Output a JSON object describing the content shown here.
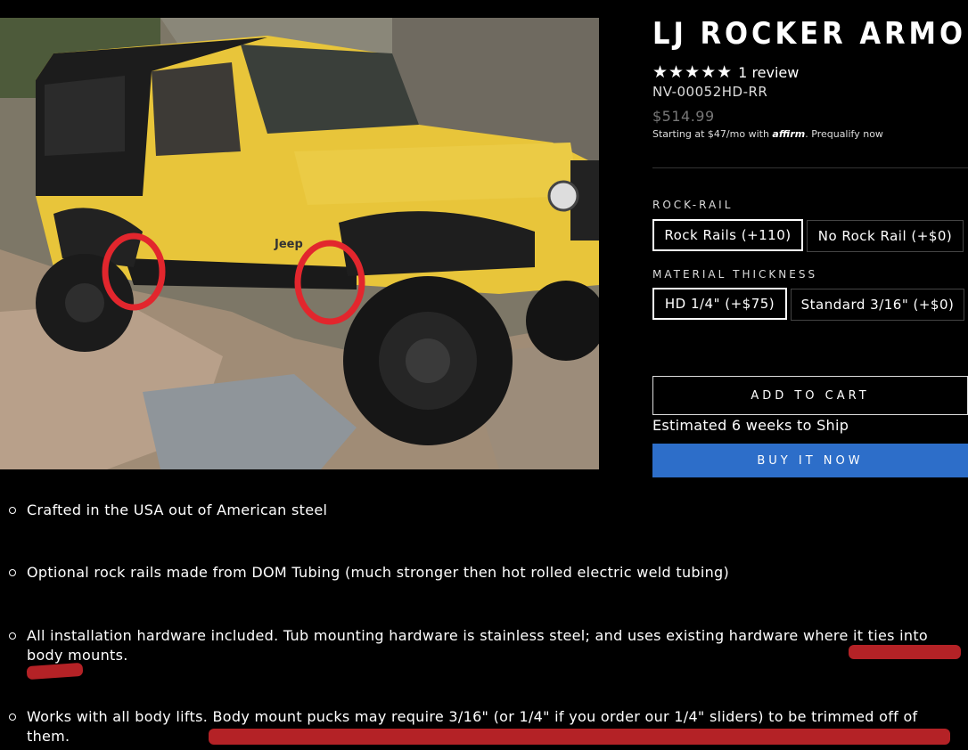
{
  "product": {
    "title": "LJ ROCKER ARMOR",
    "stars": "★★★★★",
    "review_count": "1 review",
    "sku": "NV-00052HD-RR",
    "price": "$514.99",
    "financing_prefix": "Starting at $47/mo with",
    "financing_brand": "affirm",
    "prequalify_link": "Prequalify now"
  },
  "options": {
    "rock_rail": {
      "label": "ROCK-RAIL",
      "choices": [
        "Rock Rails (+110)",
        "No Rock Rail (+$0)"
      ],
      "selected": "Rock Rails (+110)"
    },
    "thickness": {
      "label": "MATERIAL THICKNESS",
      "choices": [
        "HD 1/4\" (+$75)",
        "Standard 3/16\" (+$0)"
      ],
      "selected": "HD 1/4\" (+$75)"
    }
  },
  "actions": {
    "add_to_cart": "ADD TO CART",
    "ship_estimate": "Estimated 6 weeks to Ship",
    "buy_now": "BUY IT NOW"
  },
  "features": [
    "Crafted in the USA out of American steel",
    "Optional rock rails made from DOM Tubing (much stronger then hot rolled electric weld tubing)",
    "All installation hardware included. Tub mounting hardware is stainless steel; and uses existing hardware where it ties into body mounts.",
    "Works with all body lifts. Body mount pucks may require 3/16\" (or 1/4\" if you order our 1/4\" sliders) to  be trimmed off of them."
  ],
  "photo": {
    "badge_text": "Jeep"
  },
  "colors": {
    "background": "#000000",
    "buy_button": "#2d6ec9",
    "annotation_red": "#c8262a",
    "jeep_yellow": "#e8c53a"
  }
}
